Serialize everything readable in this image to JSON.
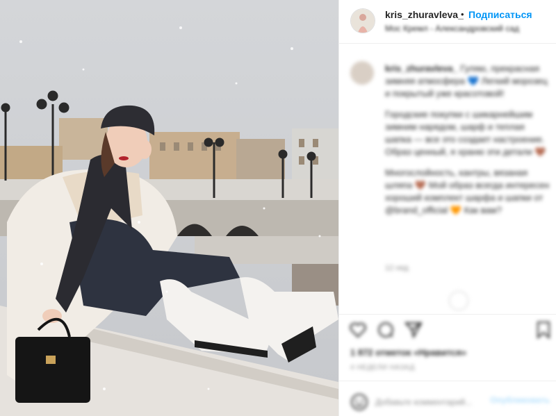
{
  "post": {
    "username": "kris_zhuravleva_",
    "separator": "•",
    "follow_label": "Подписаться",
    "location": "Мос Кремл - Александровский сад"
  },
  "caption": {
    "username": "kris_zhuravleva_",
    "paragraph1": "Гуляю, прекрасная зимняя атмосфера 💙 Легкий морозец и покрытый уже красотовой!",
    "paragraph2": "Городские покупки с шикарнейшим зимним нарядом, шарф и теплая шапка — все это создает настроение. Образ ценный, я храню эти детали 🤎",
    "paragraph3": "Многослойность, кантры, вязаная шляпа 🤎 Мой образ всегда интересен хороший комплект шарфа и шапки от @brand_official 🧡 Как вам?",
    "time": "12 нед"
  },
  "engagement": {
    "likes": "1 872 отметок «Нравится»",
    "date": "4 НЕДЕЛИ НАЗАД"
  },
  "comment_box": {
    "placeholder": "Добавьте комментарий...",
    "publish_label": "Опубликовать"
  },
  "icons": {
    "like": "heart-icon",
    "comment": "comment-icon",
    "share": "share-icon",
    "save": "bookmark-icon",
    "emoji": "emoji-icon"
  }
}
